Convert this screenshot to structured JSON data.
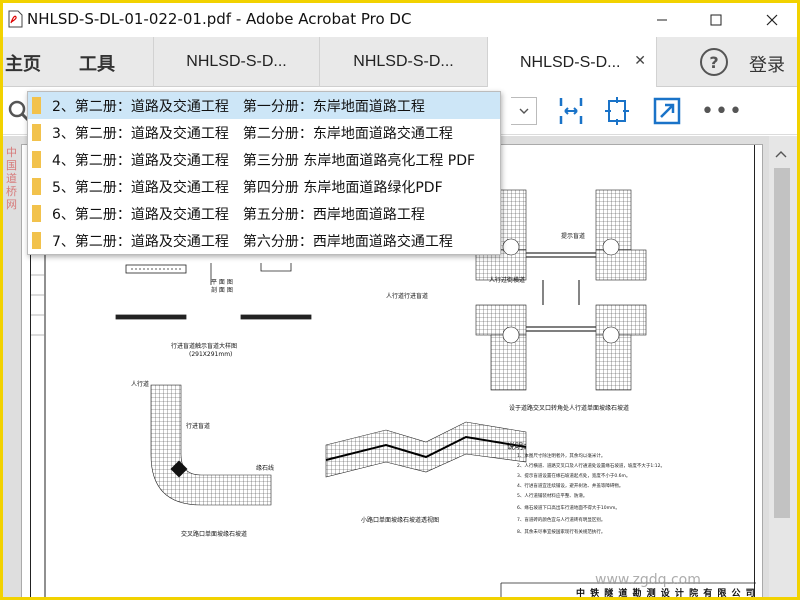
{
  "window": {
    "title": "NHLSD-S-DL-01-022-01.pdf - Adobe Acrobat Pro DC",
    "minimize": "—",
    "maximize": "☐",
    "close": "✕"
  },
  "nav": {
    "home": "主页",
    "tools": "工具"
  },
  "tabs": [
    {
      "label": "NHLSD-S-D..."
    },
    {
      "label": "NHLSD-S-D..."
    },
    {
      "label": "NHLSD-S-D...",
      "close": "✕",
      "active": true
    }
  ],
  "header": {
    "help": "?",
    "sign_in": "登录"
  },
  "toolbar": {
    "icons": [
      "search-icon",
      "fit-width-icon",
      "rotate-icon",
      "fullscreen-icon",
      "more-icon"
    ],
    "more": "•••"
  },
  "suggestions": [
    {
      "label": "2、第二册：道路及交通工程　第一分册：东岸地面道路工程",
      "selected": true
    },
    {
      "label": "3、第二册：道路及交通工程　第二分册：东岸地面道路交通工程"
    },
    {
      "label": "4、第二册：道路及交通工程　第三分册 东岸地面道路亮化工程 PDF"
    },
    {
      "label": "5、第二册：道路及交通工程　第四分册 东岸地面道路绿化PDF"
    },
    {
      "label": "6、第二册：道路及交通工程　第五分册：西岸地面道路工程"
    },
    {
      "label": "7、第二册：道路及交通工程　第六分册：西岸地面道路交通工程"
    }
  ],
  "drawing": {
    "labels": {
      "walk_curb_detail": "行进盲道触示盲道大样图",
      "size": "(291X291mm)",
      "walkway_street": "人行道行进盲道",
      "intersection_corner": "设于道路交叉口转角处人行道单面坡缘石坡道",
      "cross_intersection": "交叉路口单面坡缘石坡道",
      "small_intersection": "小路口单面坡缘石坡道透视图",
      "sidewalk": "人行道",
      "flat": "平 面 图",
      "section": "剖 面 图",
      "crosswalk": "人行过街横道",
      "curb": "缘石线",
      "tactile": "提示盲道",
      "guide": "行进盲道"
    },
    "notes_title": "说明：",
    "notes": [
      "1、本图尺寸除注明者外，其余均以毫米计。",
      "2、人行横道、道路交叉口及人行通道处设置缘石坡道，坡度不大于1:12。",
      "3、提示盲道设置在缘石坡道起点处，宽度不小于0.6m。",
      "4、行进盲道宜连续铺设，避开树池、井盖等障碍物。",
      "5、人行道铺装材料应平整、防滑。",
      "6、缘石坡道下口高出车行道地面不得大于10mm。",
      "7、盲道砖的颜色宜与人行道砖有明显区别。",
      "8、其余未尽事宜按国家现行有关规范执行。"
    ],
    "company": "中 铁 隧 道 勘 测 设 计 院 有 限 公 司",
    "watermark_left": "中国道桥网",
    "watermark_bottom": "www.zgdq.com"
  }
}
